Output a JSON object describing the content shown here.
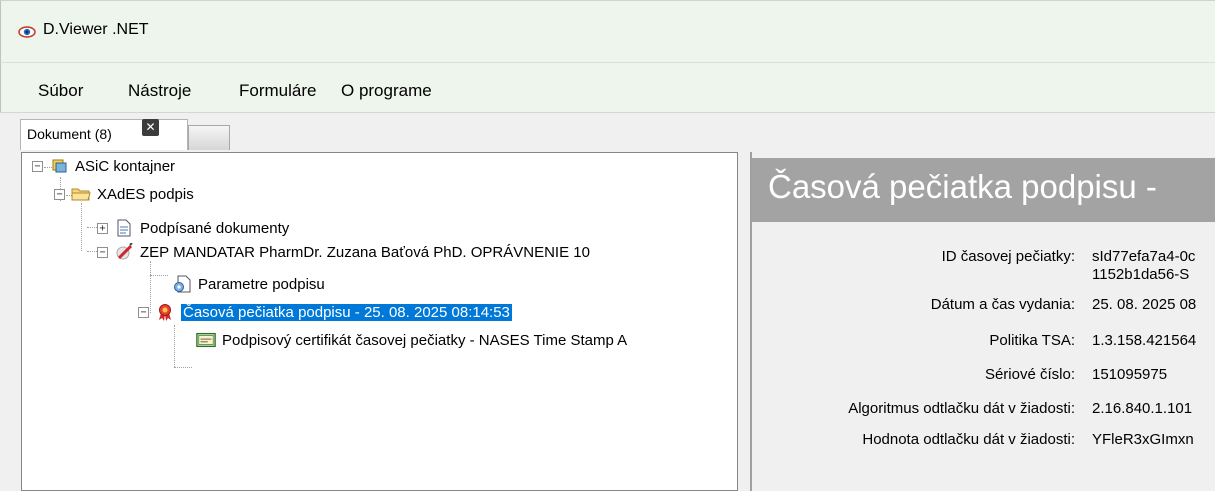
{
  "window": {
    "title": "D.Viewer .NET",
    "icon": "eye-icon"
  },
  "menu": [
    {
      "label": "Súbor"
    },
    {
      "label": "Nástroje"
    },
    {
      "label": "Formuláre"
    },
    {
      "label": "O programe"
    }
  ],
  "tabs": [
    {
      "label": "Dokument (8)",
      "close_icon": "close-icon"
    }
  ],
  "tree": [
    {
      "label": "ASiC kontajner",
      "icon": "container-icon",
      "expander": "−"
    },
    {
      "label": "XAdES podpis",
      "icon": "folder-icon",
      "expander": "−"
    },
    {
      "label": "Podpísané dokumenty",
      "icon": "document-icon",
      "expander": "+"
    },
    {
      "label": "ZEP MANDATAR PharmDr. Zuzana Baťová PhD. OPRÁVNENIE 10",
      "icon": "signature-pen-icon",
      "expander": "−"
    },
    {
      "label": "Parametre podpisu",
      "icon": "settings-document-icon",
      "expander": ""
    },
    {
      "label": "Časová pečiatka podpisu - 25. 08. 2025 08:14:53",
      "icon": "ribbon-seal-icon",
      "expander": "−",
      "selected": true
    },
    {
      "label": "Podpisový certifikát časovej pečiatky - NASES Time Stamp A",
      "icon": "certificate-icon",
      "expander": ""
    }
  ],
  "detail": {
    "header": "Časová pečiatka podpisu -",
    "properties": [
      {
        "label": "ID časovej pečiatky:",
        "value": "sId77efa7a4-0c",
        "value2": "1152b1da56-S"
      },
      {
        "label": "Dátum a čas vydania:",
        "value": "25. 08. 2025 08"
      },
      {
        "label": "Politika TSA:",
        "value": "1.3.158.421564"
      },
      {
        "label": "Sériové číslo:",
        "value": "151095975"
      },
      {
        "label": "Algoritmus odtlačku dát v žiadosti:",
        "value": "2.16.840.1.101"
      },
      {
        "label": "Hodnota odtlačku dát v žiadosti:",
        "value": "YFleR3xGImxn"
      }
    ]
  },
  "colors": {
    "selection": "#0078d7",
    "header_bg": "#a3a3a3",
    "chrome_bg": "#eef5ec"
  }
}
